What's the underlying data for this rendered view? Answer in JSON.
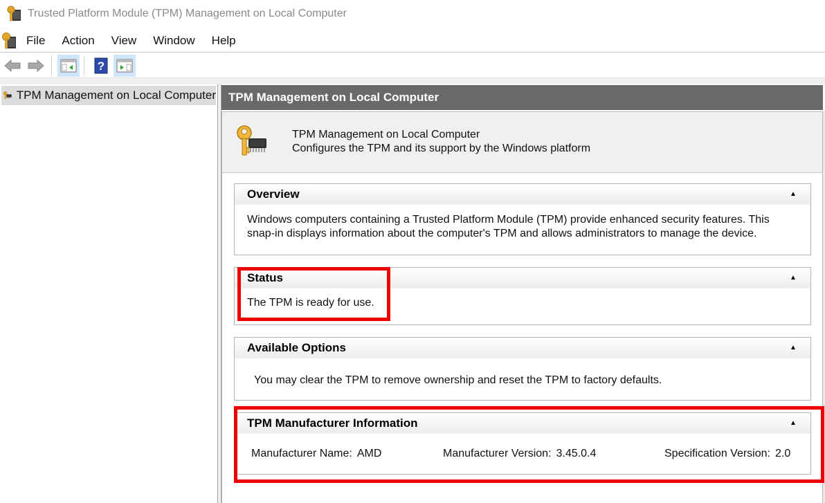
{
  "window": {
    "title": "Trusted Platform Module (TPM) Management on Local Computer",
    "app_icon": "tpm-key-chip-icon"
  },
  "menubar": {
    "items": [
      {
        "label": "File"
      },
      {
        "label": "Action"
      },
      {
        "label": "View"
      },
      {
        "label": "Window"
      },
      {
        "label": "Help"
      }
    ]
  },
  "toolbar": {
    "buttons": [
      {
        "icon": "back-arrow-icon",
        "enabled": false
      },
      {
        "icon": "forward-arrow-icon",
        "enabled": false
      },
      {
        "icon": "show-hide-console-tree-icon",
        "active": true
      },
      {
        "icon": "help-icon",
        "active": false
      },
      {
        "icon": "show-hide-action-pane-icon",
        "active": true
      }
    ]
  },
  "tree": {
    "items": [
      {
        "label": "TPM Management on Local Computer",
        "selected": true
      }
    ]
  },
  "content": {
    "header": "TPM Management on Local Computer",
    "intro": {
      "title": "TPM Management on Local Computer",
      "description": "Configures the TPM and its support by the Windows platform"
    },
    "sections": {
      "overview": {
        "title": "Overview",
        "line1": "Windows computers containing a Trusted Platform Module (TPM) provide enhanced security features. This",
        "line2": "snap-in displays information about the computer's TPM and allows administrators to manage the device.",
        "toggle": "▲"
      },
      "status": {
        "title": "Status",
        "text": "The TPM is ready for use.",
        "toggle": "▲"
      },
      "options": {
        "title": "Available Options",
        "text": "You may clear the TPM to remove ownership and reset the TPM to factory defaults.",
        "toggle": "▲"
      },
      "manufacturer": {
        "title": "TPM Manufacturer Information",
        "toggle": "▲",
        "name_label": "Manufacturer Name:",
        "name_value": "AMD",
        "version_label": "Manufacturer Version:",
        "version_value": "3.45.0.4",
        "spec_label": "Specification Version:",
        "spec_value": "2.0"
      }
    }
  },
  "annotations": {
    "highlight_color": "#ee0000",
    "highlighted": [
      "status",
      "manufacturer"
    ]
  }
}
